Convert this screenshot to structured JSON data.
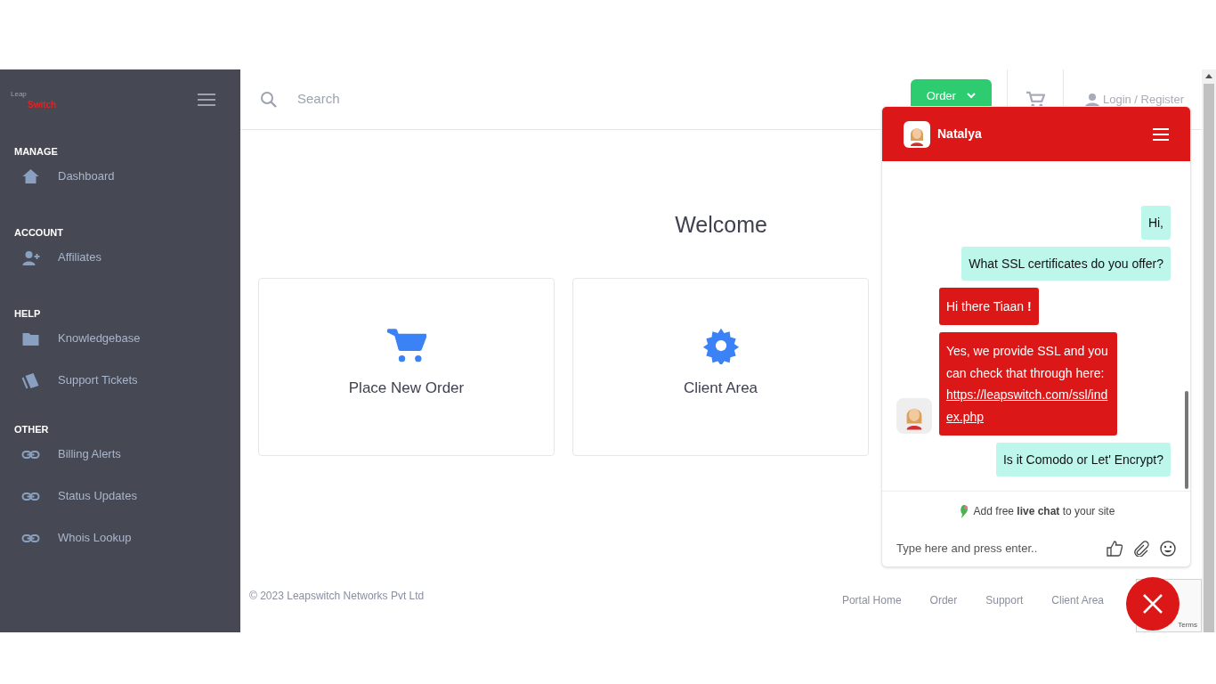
{
  "logo": {
    "leap": "Leap",
    "switch": "Switch"
  },
  "sidebar": {
    "sections": [
      {
        "heading": "MANAGE",
        "items": [
          {
            "label": "Dashboard"
          }
        ]
      },
      {
        "heading": "ACCOUNT",
        "items": [
          {
            "label": "Affiliates"
          }
        ]
      },
      {
        "heading": "HELP",
        "items": [
          {
            "label": "Knowledgebase"
          },
          {
            "label": "Support Tickets"
          }
        ]
      },
      {
        "heading": "OTHER",
        "items": [
          {
            "label": "Billing Alerts"
          },
          {
            "label": "Status Updates"
          },
          {
            "label": "Whois Lookup"
          }
        ]
      }
    ]
  },
  "header": {
    "search": {
      "placeholder": "Search"
    },
    "order_button": "Order",
    "login": "Login / Register"
  },
  "welcome": "Welcome",
  "cards": [
    {
      "label": "Place New Order"
    },
    {
      "label": "Client Area"
    }
  ],
  "footer": {
    "copyright": "© 2023 Leapswitch Networks Pvt Ltd",
    "links": [
      "Portal Home",
      "Order",
      "Support",
      "Client Area"
    ]
  },
  "chat": {
    "agent": "Natalya",
    "messages": [
      {
        "kind": "visitor",
        "text": "Hi,"
      },
      {
        "kind": "visitor",
        "text": "What SSL certificates do you offer?"
      },
      {
        "kind": "agent",
        "text": "Hi there Tiaan **!**",
        "avatar": false
      },
      {
        "kind": "agent",
        "text": "Yes, we provide SSL and you can check that through here:",
        "link": "https://leapswitch.com/ssl/index.php",
        "avatar": true
      },
      {
        "kind": "visitor",
        "text": "Is it Comodo or Let' Encrypt?"
      }
    ],
    "promo": "Add free **live chat** to your site",
    "input": {
      "placeholder": "Type here and press enter.."
    }
  },
  "recaptcha": {
    "text": "Terms"
  }
}
